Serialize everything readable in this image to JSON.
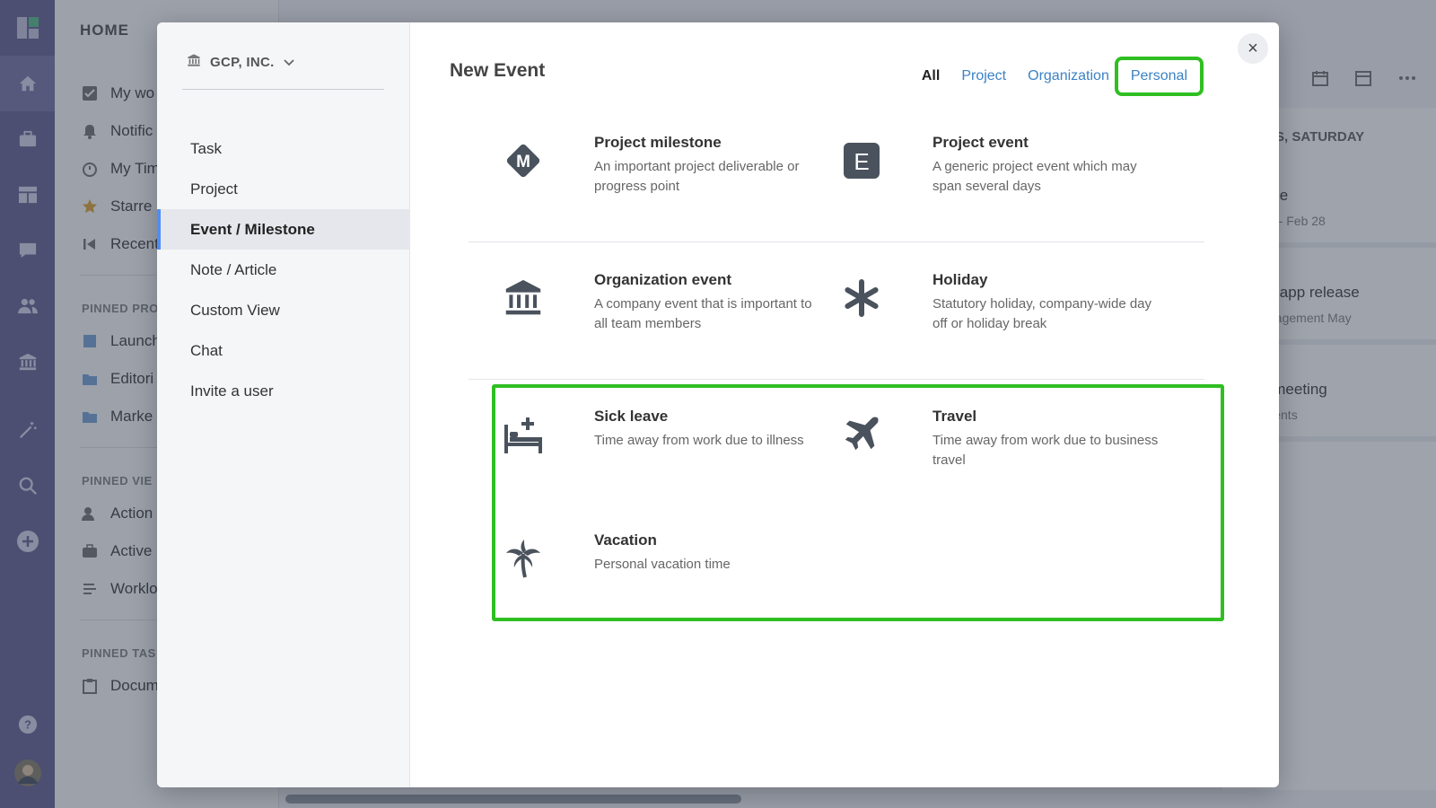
{
  "background": {
    "sidebar": {
      "title": "HOME",
      "items": [
        {
          "label": "My wo",
          "icon": "checkbox-icon"
        },
        {
          "label": "Notific",
          "icon": "bell-icon"
        },
        {
          "label": "My Tim",
          "icon": "timer-icon"
        },
        {
          "label": "Starre",
          "icon": "star-icon"
        },
        {
          "label": "Recent",
          "icon": "recent-icon"
        }
      ],
      "pinned_projects_label": "PINNED PRO",
      "pinned_projects": [
        "Launch",
        "Editori",
        "Marke"
      ],
      "pinned_views_label": "PINNED VIE",
      "pinned_views": [
        "Action",
        "Active",
        "Worklo"
      ],
      "pinned_tasks_label": "PINNED TAS",
      "pinned_tasks": [
        "Docum"
      ]
    },
    "calendar": {
      "day_header": "S, SATURDAY",
      "cards": [
        {
          "title": "te article",
          "sub": "t  Jan 16 - Feb 28"
        },
        {
          "title": "mobile app release",
          "sub": "uct management   May"
        },
        {
          "title": "nge a meeting",
          "sub": "New Clients"
        }
      ]
    }
  },
  "modal": {
    "org_name": "GCP, INC.",
    "menu": [
      "Task",
      "Project",
      "Event / Milestone",
      "Note / Article",
      "Custom View",
      "Chat",
      "Invite a user"
    ],
    "active_menu_index": 2,
    "title": "New Event",
    "filters": [
      "All",
      "Project",
      "Organization",
      "Personal"
    ],
    "close_label": "×",
    "options": [
      {
        "name": "Project milestone",
        "desc": "An important project deliverable or progress point",
        "icon": "milestone-icon"
      },
      {
        "name": "Project event",
        "desc": "A generic project event which may span several days",
        "icon": "project-event-icon"
      },
      {
        "name": "Organization event",
        "desc": "A company event that is important to all team members",
        "icon": "bank-icon"
      },
      {
        "name": "Holiday",
        "desc": "Statutory holiday, company-wide day off or holiday break",
        "icon": "asterisk-icon"
      },
      {
        "name": "Sick leave",
        "desc": "Time away from work due to illness",
        "icon": "bed-icon"
      },
      {
        "name": "Travel",
        "desc": "Time away from work due to business travel",
        "icon": "airplane-icon"
      },
      {
        "name": "Vacation",
        "desc": "Personal vacation time",
        "icon": "palm-tree-icon"
      }
    ],
    "highlight_color": "#2fbf22"
  }
}
